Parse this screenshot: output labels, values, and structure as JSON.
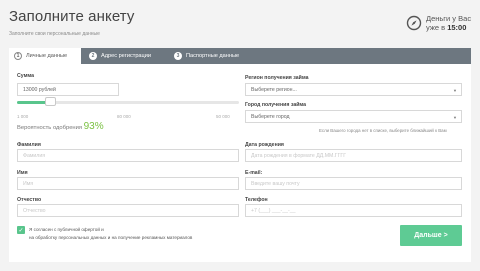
{
  "header": {
    "title": "Заполните анкету",
    "subtitle": "Заполните свои персональные данные",
    "timer_line1": "Деньги у Вас",
    "timer_prefix": "уже в",
    "timer_time": "15:00",
    "timer_icon": "compass-icon"
  },
  "tabs": [
    {
      "num": "1",
      "label": "Личные данные"
    },
    {
      "num": "2",
      "label": "Адрес регистрации"
    },
    {
      "num": "3",
      "label": "Паспортные данные"
    }
  ],
  "form": {
    "amount_label": "Сумма",
    "amount_value": "13000 рублей",
    "slider_min": "1 000",
    "slider_mid": "80 000",
    "slider_max": "50 000",
    "slider_fraction": 0.15,
    "approval_label": "Вероятность одобрения",
    "approval_value": "93%",
    "region_label": "Регион получения займа",
    "region_value": "Выберете регион...",
    "city_label": "Город получения займа",
    "city_value": "Выберете город",
    "city_note": "Если Вашего города нет в списке, выберите ближайший к Вам",
    "lastname_label": "Фамилия",
    "lastname_placeholder": "Фамилия",
    "birth_label": "Дата рождения",
    "birth_placeholder": "Дата рождения в формате ДД.ММ.ГГГГ",
    "firstname_label": "Имя",
    "firstname_placeholder": "Имя",
    "email_label": "E-mail:",
    "email_placeholder": "Введите вашу почту",
    "patronymic_label": "Отчество",
    "patronymic_placeholder": "Отчество",
    "phone_label": "Телефон",
    "phone_placeholder": "+7 (___) ___-__-__",
    "consent_line1": "Я согласен с публичной офертой и",
    "consent_line2": "на обработку персональных данных и на получение рекламных материалов",
    "next_label": "Дальше >"
  },
  "colors": {
    "accent": "#5ecb94",
    "tabbar": "#6d7780",
    "approval": "#7ac142"
  }
}
